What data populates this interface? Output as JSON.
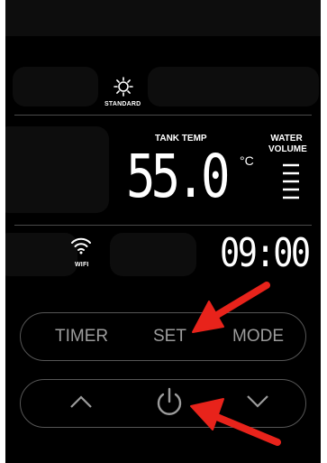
{
  "display": {
    "mode_label": "STANDARD",
    "tank_temp_label": "TANK TEMP",
    "temperature_value": "55.0",
    "temperature_unit": "°C",
    "water_volume_label_line1": "WATER",
    "water_volume_label_line2": "VOLUME",
    "water_volume_level_bars": 5,
    "wifi_label": "WIFI",
    "clock_value": "09:00"
  },
  "controls": {
    "timer_label": "TIMER",
    "set_label": "SET",
    "mode_label": "MODE"
  },
  "icons": {
    "sun": "sun-icon",
    "wifi": "wifi-icon",
    "up": "chevron-up-icon",
    "power": "power-icon",
    "down": "chevron-down-icon",
    "arrows": "red-arrow-annotation"
  },
  "colors": {
    "panel_background": "#000000",
    "display_text": "#ffffff",
    "button_text": "#9c9c9c",
    "annotation_arrow": "#e8231b"
  }
}
